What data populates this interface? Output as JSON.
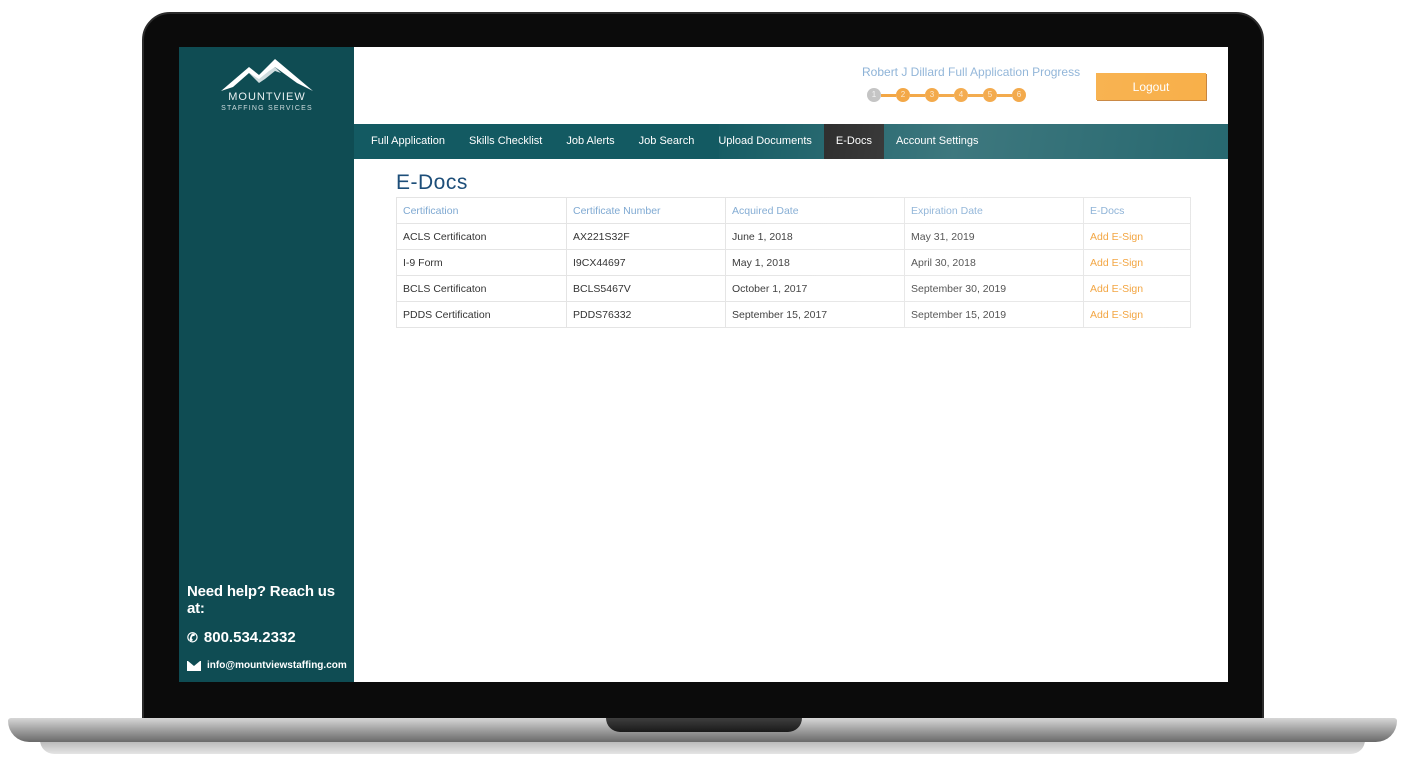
{
  "brand": {
    "name": "MOUNTVIEW",
    "tagline": "STAFFING SERVICES"
  },
  "help": {
    "title": "Need help? Reach us at:",
    "phone": "800.534.2332",
    "email": "info@mountviewstaffing.com",
    "phone_icon": "phone-icon",
    "email_icon": "envelope-icon"
  },
  "header": {
    "progress_title": "Robert J Dillard Full Application Progress",
    "logout_label": "Logout",
    "progress_steps": [
      "1",
      "2",
      "3",
      "4",
      "5",
      "6"
    ],
    "completed_steps": 1
  },
  "nav": {
    "items": [
      {
        "label": "Full Application"
      },
      {
        "label": "Skills Checklist"
      },
      {
        "label": "Job Alerts"
      },
      {
        "label": "Job Search"
      },
      {
        "label": "Upload Documents"
      },
      {
        "label": "E-Docs"
      },
      {
        "label": "Account Settings"
      }
    ],
    "active_index": 5
  },
  "page": {
    "title": "E-Docs"
  },
  "table": {
    "headers": [
      "Certification",
      "Certificate Number",
      "Acquired Date",
      "Expiration Date",
      "E-Docs"
    ],
    "rows": [
      [
        "ACLS Certificaton",
        "AX221S32F",
        "June 1, 2018",
        "May 31, 2019",
        "Add E-Sign"
      ],
      [
        "I-9 Form",
        "I9CX44697",
        "May 1, 2018",
        "April 30, 2018",
        "Add E-Sign"
      ],
      [
        "BCLS Certificaton",
        "BCLS5467V",
        "October 1, 2017",
        "September 30, 2019",
        "Add E-Sign"
      ],
      [
        "PDDS Certification",
        "PDDS76332",
        "September 15, 2017",
        "September 15, 2019",
        "Add E-Sign"
      ]
    ]
  },
  "colors": {
    "sidebar": "#0f4c53",
    "nav": "#135a62",
    "accent": "#f19a2a",
    "title": "#1d4e79",
    "header_text": "#7fa9d2"
  }
}
